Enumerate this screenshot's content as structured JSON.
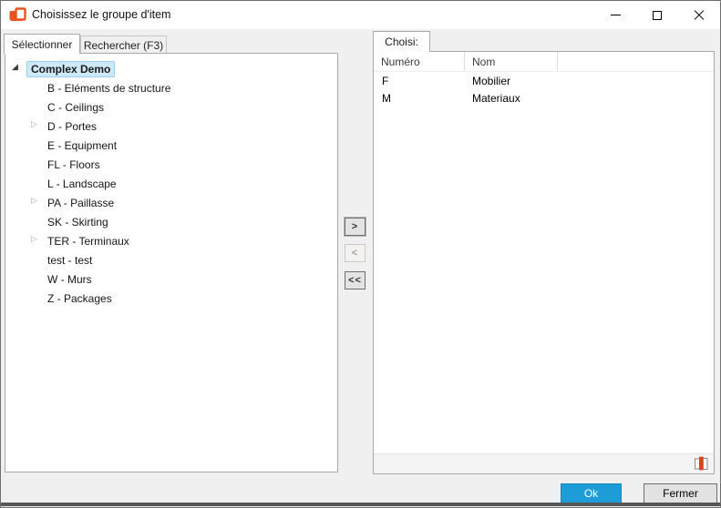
{
  "window": {
    "title": "Choisissez le groupe d'item"
  },
  "tabs": {
    "selectionner": "Sélectionner",
    "rechercher": "Rechercher (F3)"
  },
  "glyphs": {
    "expanded": "◢",
    "collapsed": "▷"
  },
  "tree": {
    "root_label": "Complex Demo",
    "items": [
      {
        "label": "B - Eléments de structure",
        "expandable": false
      },
      {
        "label": "C - Ceilings",
        "expandable": false
      },
      {
        "label": "D - Portes",
        "expandable": true
      },
      {
        "label": "E - Equipment",
        "expandable": false
      },
      {
        "label": "FL - Floors",
        "expandable": false
      },
      {
        "label": "L - Landscape",
        "expandable": false
      },
      {
        "label": "PA - Paillasse",
        "expandable": true
      },
      {
        "label": "SK - Skirting",
        "expandable": false
      },
      {
        "label": "TER - Terminaux",
        "expandable": true
      },
      {
        "label": "test - test",
        "expandable": false
      },
      {
        "label": "W - Murs",
        "expandable": false
      },
      {
        "label": "Z - Packages",
        "expandable": false
      }
    ]
  },
  "transfer": {
    "add": ">",
    "remove": "<",
    "remove_all": "<<"
  },
  "chosen": {
    "tab_label": "Choisi:",
    "columns": {
      "numero": "Numéro",
      "nom": "Nom"
    },
    "rows": [
      {
        "numero": "F",
        "nom": "Mobilier"
      },
      {
        "numero": "M",
        "nom": "Materiaux"
      }
    ]
  },
  "footer": {
    "ok": "Ok",
    "close": "Fermer"
  },
  "colors": {
    "accent_blue": "#1e9cd8",
    "selection_bg": "#cde8f6",
    "icon_orange": "#e8531f",
    "book_spine_red": "#e8421d"
  }
}
